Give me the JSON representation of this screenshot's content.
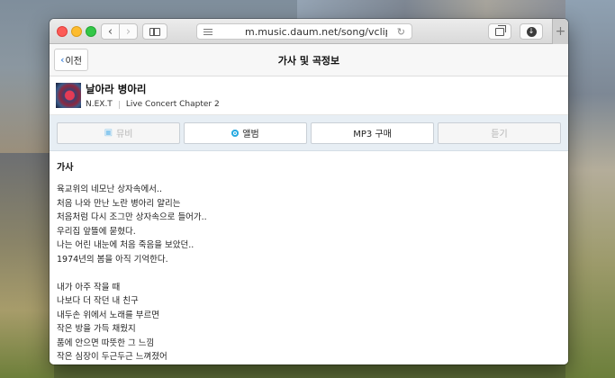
{
  "browser": {
    "url": "m.music.daum.net/song/vcliplyrics",
    "back_glyph": "‹",
    "forward_glyph": "›",
    "reload_glyph": "↻",
    "download_glyph": "↓",
    "new_tab_glyph": "+"
  },
  "header": {
    "back_label": "이전",
    "back_chevron": "‹",
    "title": "가사 및 곡정보"
  },
  "song": {
    "title": "날아라 병아리",
    "artist": "N.EX.T",
    "album": "Live Concert Chapter 2"
  },
  "actions": [
    {
      "label": "뮤비",
      "icon": "mv-icon",
      "glyph": "▣",
      "enabled": false
    },
    {
      "label": "앨범",
      "icon": "album-icon",
      "glyph": "",
      "enabled": true
    },
    {
      "label": "MP3 구매",
      "icon": "",
      "glyph": "",
      "enabled": true
    },
    {
      "label": "듣기",
      "icon": "",
      "glyph": "",
      "enabled": false
    }
  ],
  "lyrics": {
    "heading": "가사",
    "lines": [
      "육교위의 네모난 상자속에서..",
      "처음 나와 만난 노란 병아리 얄리는",
      "처음처럼 다시 조그만 상자속으로 들어가..",
      "우리집 앞뜰에 묻혔다.",
      "나는 어린 내눈에 처음 죽음을 보았던..",
      "1974년의 봄을 아직 기억한다.",
      "",
      "내가 아주 작을 때",
      "나보다 더 작던 내 친구",
      "내두손 위에서 노래를 부르면",
      "작은 방을 가득 채웠지",
      "품에 안으면 따뜻한 그 느낌",
      "작은 심장이 두근두근 느껴졌어"
    ]
  },
  "colors": {
    "accent": "#26a9e0",
    "link_blue": "#1f70d6",
    "action_bar_bg": "#e7eef4"
  }
}
